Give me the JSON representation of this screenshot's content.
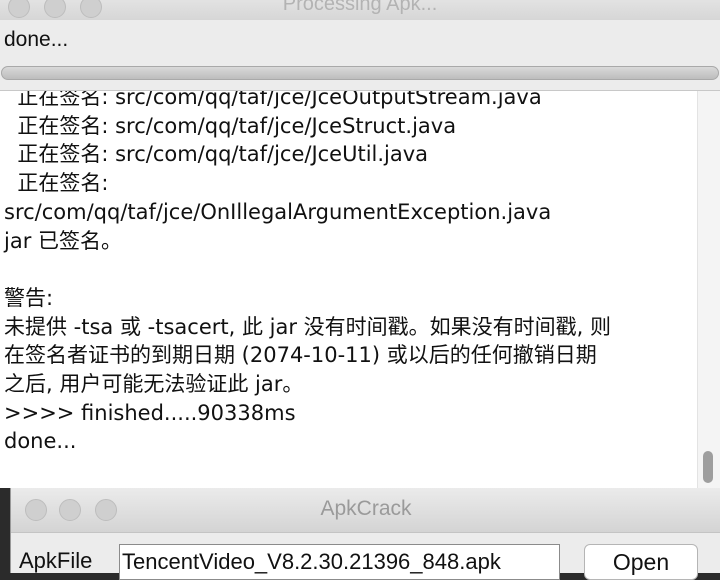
{
  "processing_window": {
    "title": "Processing Apk...",
    "status": "done...",
    "progress_percent": 100,
    "log_lines": [
      "  正在签名: src/com/qq/taf/jce/JceOutputStream.java",
      "  正在签名: src/com/qq/taf/jce/JceStruct.java",
      "  正在签名: src/com/qq/taf/jce/JceUtil.java",
      "  正在签名:",
      "src/com/qq/taf/jce/OnIllegalArgumentException.java",
      "jar 已签名。",
      "",
      "警告:",
      "未提供 -tsa 或 -tsacert, 此 jar 没有时间戳。如果没有时间戳, 则",
      "在签名者证书的到期日期 (2074-10-11) 或以后的任何撤销日期",
      "之后, 用户可能无法验证此 jar。",
      ">>>> finished.....90338ms",
      "done..."
    ]
  },
  "apkcrack_window": {
    "title": "ApkCrack",
    "apkfile_label": "ApkFile",
    "apkfile_value": "TencentVideo_V8.2.30.21396_848.apk",
    "open_button": "Open"
  }
}
